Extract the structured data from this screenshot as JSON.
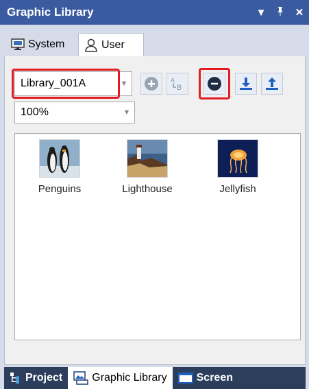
{
  "window": {
    "title": "Graphic Library",
    "controls": [
      "dropdown-icon",
      "pin-icon",
      "close-icon"
    ]
  },
  "tabs": [
    {
      "label": "System",
      "icon": "monitor-icon",
      "active": false
    },
    {
      "label": "User",
      "icon": "user-icon",
      "active": true
    }
  ],
  "toolbar": {
    "library_select_value": "Library_001A",
    "zoom_select_value": "100%",
    "buttons": [
      "add-icon",
      "rename-icon",
      "remove-icon",
      "import-icon",
      "export-icon"
    ]
  },
  "gallery": {
    "items": [
      {
        "label": "Penguins"
      },
      {
        "label": "Lighthouse"
      },
      {
        "label": "Jellyfish"
      }
    ]
  },
  "bottom_tabs": [
    {
      "label": "Project",
      "active": false
    },
    {
      "label": "Graphic Library",
      "active": true
    },
    {
      "label": "Screen",
      "active": false
    }
  ],
  "colors": {
    "title_bar": "#3a5ba0",
    "highlight": "#e31b23",
    "bottom_bar": "#2c3e5c"
  }
}
